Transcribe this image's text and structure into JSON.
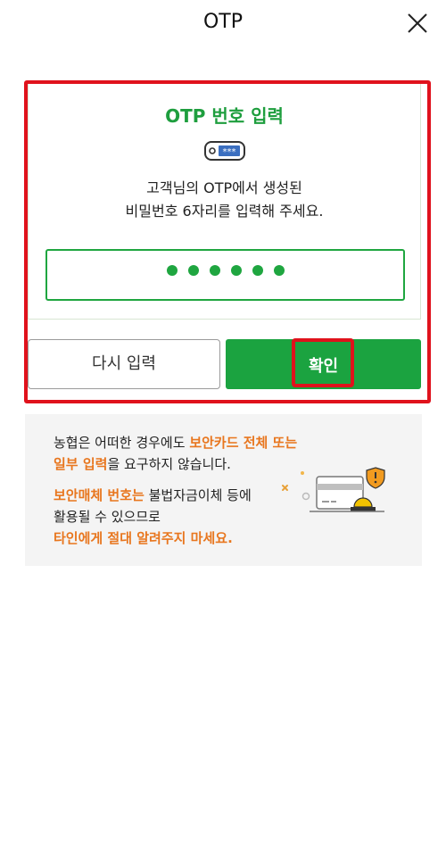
{
  "header": {
    "title": "OTP",
    "close_icon": "close-icon"
  },
  "otp_panel": {
    "title": "OTP 번호 입력",
    "icon": "otp-token-icon",
    "description_line1": "고객님의 OTP에서 생성된",
    "description_line2": "비밀번호 6자리를 입력해 주세요.",
    "input_digits_entered": 6,
    "input_mask": "●●●●●●"
  },
  "buttons": {
    "reset_label": "다시 입력",
    "confirm_label": "확인"
  },
  "notice": {
    "line1_prefix": "농협은 어떠한 경우에도 ",
    "line1_highlight": "보안카드 전체 또는",
    "line2_highlight": "일부 입력",
    "line2_suffix": "을 요구하지 않습니다.",
    "line3_highlight": "보안매체 번호는",
    "line3_suffix": " 불법자금이체 등에",
    "line4": "활용될 수 있으므로",
    "line5_highlight": "타인에게 절대 알려주지 마세요.",
    "illustration": "security-card-warning-illustration"
  },
  "colors": {
    "brand_green": "#1ba340",
    "highlight_red": "#e0121c",
    "warning_orange": "#e8761e"
  }
}
